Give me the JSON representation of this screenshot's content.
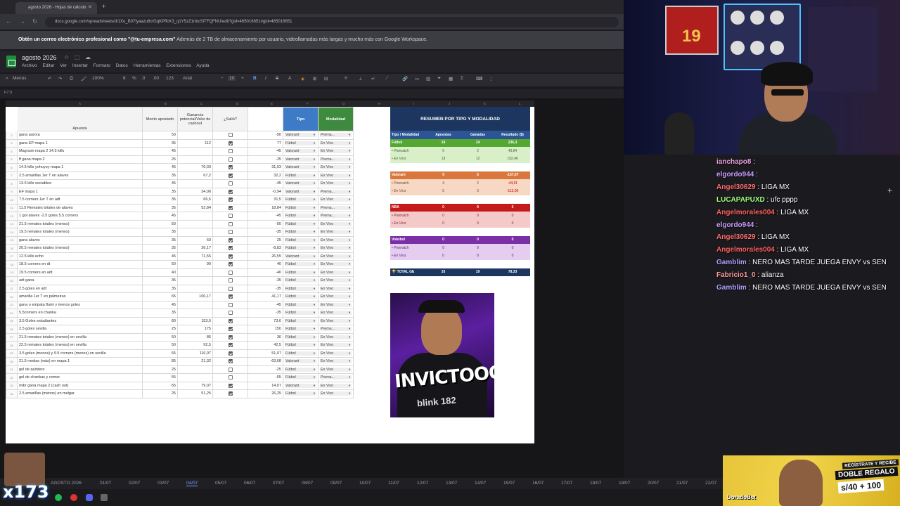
{
  "browser": {
    "tab_title": "agosto 2026 - Hojas de cálculo",
    "url": "docs.google.com/spreadsheets/d/1Xo_B07Iyaazu6cIGqKPffcK3_q1Y5zZ1nbcSiTFQFNU/edit?gid=465016651#gid=465016651"
  },
  "banner": {
    "bold": "Obtén un correo electrónico profesional como \"@tu-empresa.com\"",
    "rest": " Además de 2 TB de almacenamiento por usuario, videollamadas más largas y mucho más con Google Workspace."
  },
  "doc": {
    "title": "agosto 2026",
    "menu": [
      "Archivo",
      "Editar",
      "Ver",
      "Insertar",
      "Formato",
      "Datos",
      "Herramientas",
      "Extensiones",
      "Ayuda"
    ],
    "toolbar": {
      "menus": "Menús",
      "zoom": "100%",
      "font": "Arial",
      "size": "10",
      "currency": "€",
      "percent": "%",
      "decimals": ".0",
      "decimals2": ".00",
      "format123": "123"
    },
    "cell_ref": "F7:9"
  },
  "columns": [
    "A",
    "B",
    "C",
    "D",
    "E",
    "F",
    "G",
    "H",
    "I",
    "J",
    "K",
    "L",
    "M",
    "N",
    "O"
  ],
  "bets_header": {
    "apuesta": "Apuesta",
    "monto": "Monto apostado",
    "ganancia": "Ganancia potencial/Valor de cashout",
    "salio": "¿Salió?",
    "tipo": "Tipo",
    "modalidad": "Modalidad"
  },
  "bets": [
    {
      "n": "2",
      "a": "gana aurora",
      "m": "50",
      "g": "",
      "s": false,
      "r": "-50",
      "t": "Valorant",
      "mo": "Prema..."
    },
    {
      "n": "3",
      "a": "gana EP mapa 1",
      "m": "35",
      "g": "112",
      "s": true,
      "r": "77",
      "t": "Fútbol",
      "mo": "En Vivo"
    },
    {
      "n": "4",
      "a": "Magnum mapa 2 14.5 kills",
      "m": "45",
      "g": "",
      "s": false,
      "r": "-45",
      "t": "Valorant",
      "mo": "En Vivo"
    },
    {
      "n": "5",
      "a": "ff gana mapa 2",
      "m": "25",
      "g": "",
      "s": false,
      "r": "-25",
      "t": "Valorant",
      "mo": "Prema..."
    },
    {
      "n": "6",
      "a": "14.5 kills yohuyoy mapa 1",
      "m": "45",
      "g": "76,03",
      "s": true,
      "r": "31,03",
      "t": "Valorant",
      "mo": "En Vivo"
    },
    {
      "n": "7",
      "a": "2.5 amarillas 1er T en alaves",
      "m": "35",
      "g": "67,2",
      "s": true,
      "r": "32,2",
      "t": "Fútbol",
      "mo": "En Vivo"
    },
    {
      "n": "8",
      "a": "13.5 kills sociablee",
      "m": "45",
      "g": "",
      "s": false,
      "r": "-45",
      "t": "Valorant",
      "mo": "En Vivo"
    },
    {
      "n": "9",
      "a": "EF mapa 1",
      "m": "35",
      "g": "34,06",
      "s": true,
      "r": "-0,94",
      "t": "Valorant",
      "mo": "Prema..."
    },
    {
      "n": "10",
      "a": "7.5 corners 1er T en adt",
      "m": "35",
      "g": "66,5",
      "s": true,
      "r": "31,5",
      "t": "Fútbol",
      "mo": "En Vivo"
    },
    {
      "n": "11",
      "a": "11.5 Remates totales de alaves",
      "m": "35",
      "g": "53,84",
      "s": true,
      "r": "18,84",
      "t": "Fútbol",
      "mo": "Prema..."
    },
    {
      "n": "12",
      "a": "1 gol alaves -2.5 goles 5.5 corners",
      "m": "45",
      "g": "",
      "s": false,
      "r": "-45",
      "t": "Fútbol",
      "mo": "Prema..."
    },
    {
      "n": "13",
      "a": "21.5 remates totales (menos)",
      "m": "50",
      "g": "",
      "s": false,
      "r": "-50",
      "t": "Fútbol",
      "mo": "En Vivo"
    },
    {
      "n": "14",
      "a": "19.5 remates totales (menos)",
      "m": "35",
      "g": "",
      "s": false,
      "r": "-35",
      "t": "Fútbol",
      "mo": "En Vivo"
    },
    {
      "n": "15",
      "a": "gana alaves",
      "m": "35",
      "g": "60",
      "s": true,
      "r": "25",
      "t": "Fútbol",
      "mo": "En Vivo"
    },
    {
      "n": "16",
      "a": "20.5 remates totales (menos)",
      "m": "35",
      "g": "26,17",
      "s": true,
      "r": "-8,83",
      "t": "Fútbol",
      "mo": "En Vivo"
    },
    {
      "n": "17",
      "a": "12.5 kills echo",
      "m": "45",
      "g": "71,55",
      "s": true,
      "r": "26,55",
      "t": "Valorant",
      "mo": "En Vivo"
    },
    {
      "n": "18",
      "a": "18.5 corners en dt",
      "m": "50",
      "g": "90",
      "s": true,
      "r": "40",
      "t": "Fútbol",
      "mo": "En Vivo"
    },
    {
      "n": "19",
      "a": "19.5 corners en adt",
      "m": "40",
      "g": "",
      "s": false,
      "r": "-40",
      "t": "Fútbol",
      "mo": "En Vivo"
    },
    {
      "n": "20",
      "a": "adt gana",
      "m": "35",
      "g": "",
      "s": false,
      "r": "-35",
      "t": "Fútbol",
      "mo": "En Vivo"
    },
    {
      "n": "21",
      "a": "2.5 goles en adt",
      "m": "35",
      "g": "",
      "s": false,
      "r": "-35",
      "t": "Fútbol",
      "mo": "En Vivo"
    },
    {
      "n": "22",
      "a": "amarilla 1er T en palmeiras",
      "m": "65",
      "g": "106,17",
      "s": true,
      "r": "41,17",
      "t": "Fútbol",
      "mo": "En Vivo"
    },
    {
      "n": "23",
      "a": "gana o empata flumi y menos goles",
      "m": "45",
      "g": "",
      "s": false,
      "r": "-45",
      "t": "Fútbol",
      "mo": "En Vivo"
    },
    {
      "n": "24",
      "a": "5.5corners  en chanka",
      "m": "35",
      "g": "",
      "s": false,
      "r": "-35",
      "t": "Fútbol",
      "mo": "En Vivo"
    },
    {
      "n": "25",
      "a": "3.5 Goles estudiantes",
      "m": "80",
      "g": "153,6",
      "s": true,
      "r": "73,6",
      "t": "Fútbol",
      "mo": "En Vivo"
    },
    {
      "n": "26",
      "a": "2.5 goles sevilla",
      "m": "25",
      "g": "175",
      "s": true,
      "r": "150",
      "t": "Fútbol",
      "mo": "Prema..."
    },
    {
      "n": "27",
      "a": "21.5 remates totales (menos) en sevilla",
      "m": "50",
      "g": "86",
      "s": true,
      "r": "36",
      "t": "Fútbol",
      "mo": "En Vivo"
    },
    {
      "n": "28",
      "a": "22.5 remates totales (menos) en sevilla",
      "m": "50",
      "g": "92,5",
      "s": true,
      "r": "42,5",
      "t": "Fútbol",
      "mo": "En Vivo"
    },
    {
      "n": "29",
      "a": "3.5 goles (menos) y 9.5 corners (menos) en sevilla",
      "m": "65",
      "g": "116,07",
      "s": true,
      "r": "51,07",
      "t": "Fútbol",
      "mo": "En Vivo"
    },
    {
      "n": "30",
      "a": "21.5 rondas (más) en mapa 1",
      "m": "85",
      "g": "21,32",
      "s": true,
      "r": "-63,68",
      "t": "Valorant",
      "mo": "En Vivo"
    },
    {
      "n": "31",
      "a": "gol de quintero",
      "m": "25",
      "g": "",
      "s": false,
      "r": "-25",
      "t": "Fútbol",
      "mo": "En Vivo"
    },
    {
      "n": "32",
      "a": "gol de chankas y comer",
      "m": "55",
      "g": "",
      "s": false,
      "r": "-55",
      "t": "Fútbol",
      "mo": "Prema..."
    },
    {
      "n": "33",
      "a": "mibr gana mapa 2 (cash out)",
      "m": "65",
      "g": "79,07",
      "s": true,
      "r": "14,07",
      "t": "Valorant",
      "mo": "En Vivo"
    },
    {
      "n": "34",
      "a": "2.5 amarillas (menos) en melgar",
      "m": "25",
      "g": "51,25",
      "s": true,
      "r": "26,25",
      "t": "Fútbol",
      "mo": "En Vivo"
    }
  ],
  "summary": {
    "title": "RESUMEN POR TIPO Y MODALIDAD",
    "headers": [
      "Tipo / Modalidad",
      "Apuestas",
      "Ganadas",
      "Resultado ($)"
    ],
    "futbol": {
      "name": "Fútbol",
      "a": "24",
      "g": "14",
      "r": "236,3"
    },
    "futbol_pre": {
      "name": "• Prematch",
      "a": "5",
      "g": "2",
      "r": "43,84"
    },
    "futbol_viv": {
      "name": "• En Vivo",
      "a": "19",
      "g": "12",
      "r": "192,46"
    },
    "valorant": {
      "name": "Valorant",
      "a": "9",
      "g": "5",
      "r": "-157,97"
    },
    "valorant_pre": {
      "name": "• Prematch",
      "a": "4",
      "g": "2",
      "r": "-44,91"
    },
    "valorant_viv": {
      "name": "• En Vivo",
      "a": "5",
      "g": "3",
      "r": "-113,06"
    },
    "nba": {
      "name": "NBA",
      "a": "0",
      "g": "0",
      "r": "0"
    },
    "nba_pre": {
      "name": "• Prematch",
      "a": "0",
      "g": "0",
      "r": "0"
    },
    "nba_viv": {
      "name": "• En Vivo",
      "a": "0",
      "g": "0",
      "r": "0"
    },
    "voleibol": {
      "name": "Voleibol",
      "a": "0",
      "g": "0",
      "r": "0"
    },
    "voleibol_pre": {
      "name": "• Prematch",
      "a": "0",
      "g": "0",
      "r": "0"
    },
    "voleibol_viv": {
      "name": "• En Vivo",
      "a": "0",
      "g": "0",
      "r": "0"
    },
    "total": {
      "name": "TOTAL GE",
      "a": "33",
      "g": "19",
      "r": "78,33"
    }
  },
  "thumbnail": {
    "text": "INVICTOOOS",
    "sub": "blink 182"
  },
  "sheet_tabs": [
    "AGOSTO 2026",
    "01/07",
    "02/07",
    "03/07",
    "04/07",
    "05/07",
    "06/07",
    "07/07",
    "08/07",
    "09/07",
    "10/07",
    "11/07",
    "12/07",
    "13/07",
    "14/07",
    "15/07",
    "16/07",
    "17/07",
    "18/07",
    "19/07",
    "20/07",
    "21/07",
    "22/07"
  ],
  "active_sheet": "04/07",
  "overlay": {
    "counter": "x173",
    "jersey_number": "19"
  },
  "chat": [
    {
      "user": "ianchapo8",
      "text": " : ",
      "color": "#e8a0e0"
    },
    {
      "user": "elgordo944",
      "text": " : ",
      "color": "#c9a0ff"
    },
    {
      "user": "Angel30629",
      "text": " : LIGA MX",
      "color": "#ff7070"
    },
    {
      "user": "LUCAPAPUXD",
      "text": " : ufc pppp",
      "color": "#a0ff7a"
    },
    {
      "user": "Angelmorales004",
      "text": " : LIGA MX",
      "color": "#ff6060"
    },
    {
      "user": "elgordo944",
      "text": " : ",
      "color": "#c9a0ff"
    },
    {
      "user": "Angel30629",
      "text": " : LIGA MX",
      "color": "#ff7070"
    },
    {
      "user": "Angelmorales004",
      "text": " : LIGA MX",
      "color": "#ff6060"
    },
    {
      "user": "Gamblim",
      "text": " : NERO MAS TARDE JUEGA ENVY vs SEN",
      "color": "#b0a0ff"
    },
    {
      "user": "Fabricio1_0",
      "text": " : alianza",
      "color": "#ff9aa0"
    },
    {
      "user": "Gamblim",
      "text": " : NERO MAS TARDE JUEGA ENVY vs SEN",
      "color": "#b0a0ff"
    }
  ],
  "ad": {
    "line1": "REGÍSTRATE Y RECIBE",
    "line2": "DOBLE REGALO",
    "promo": "s/40 + 100",
    "brand": "DoradoBet"
  }
}
